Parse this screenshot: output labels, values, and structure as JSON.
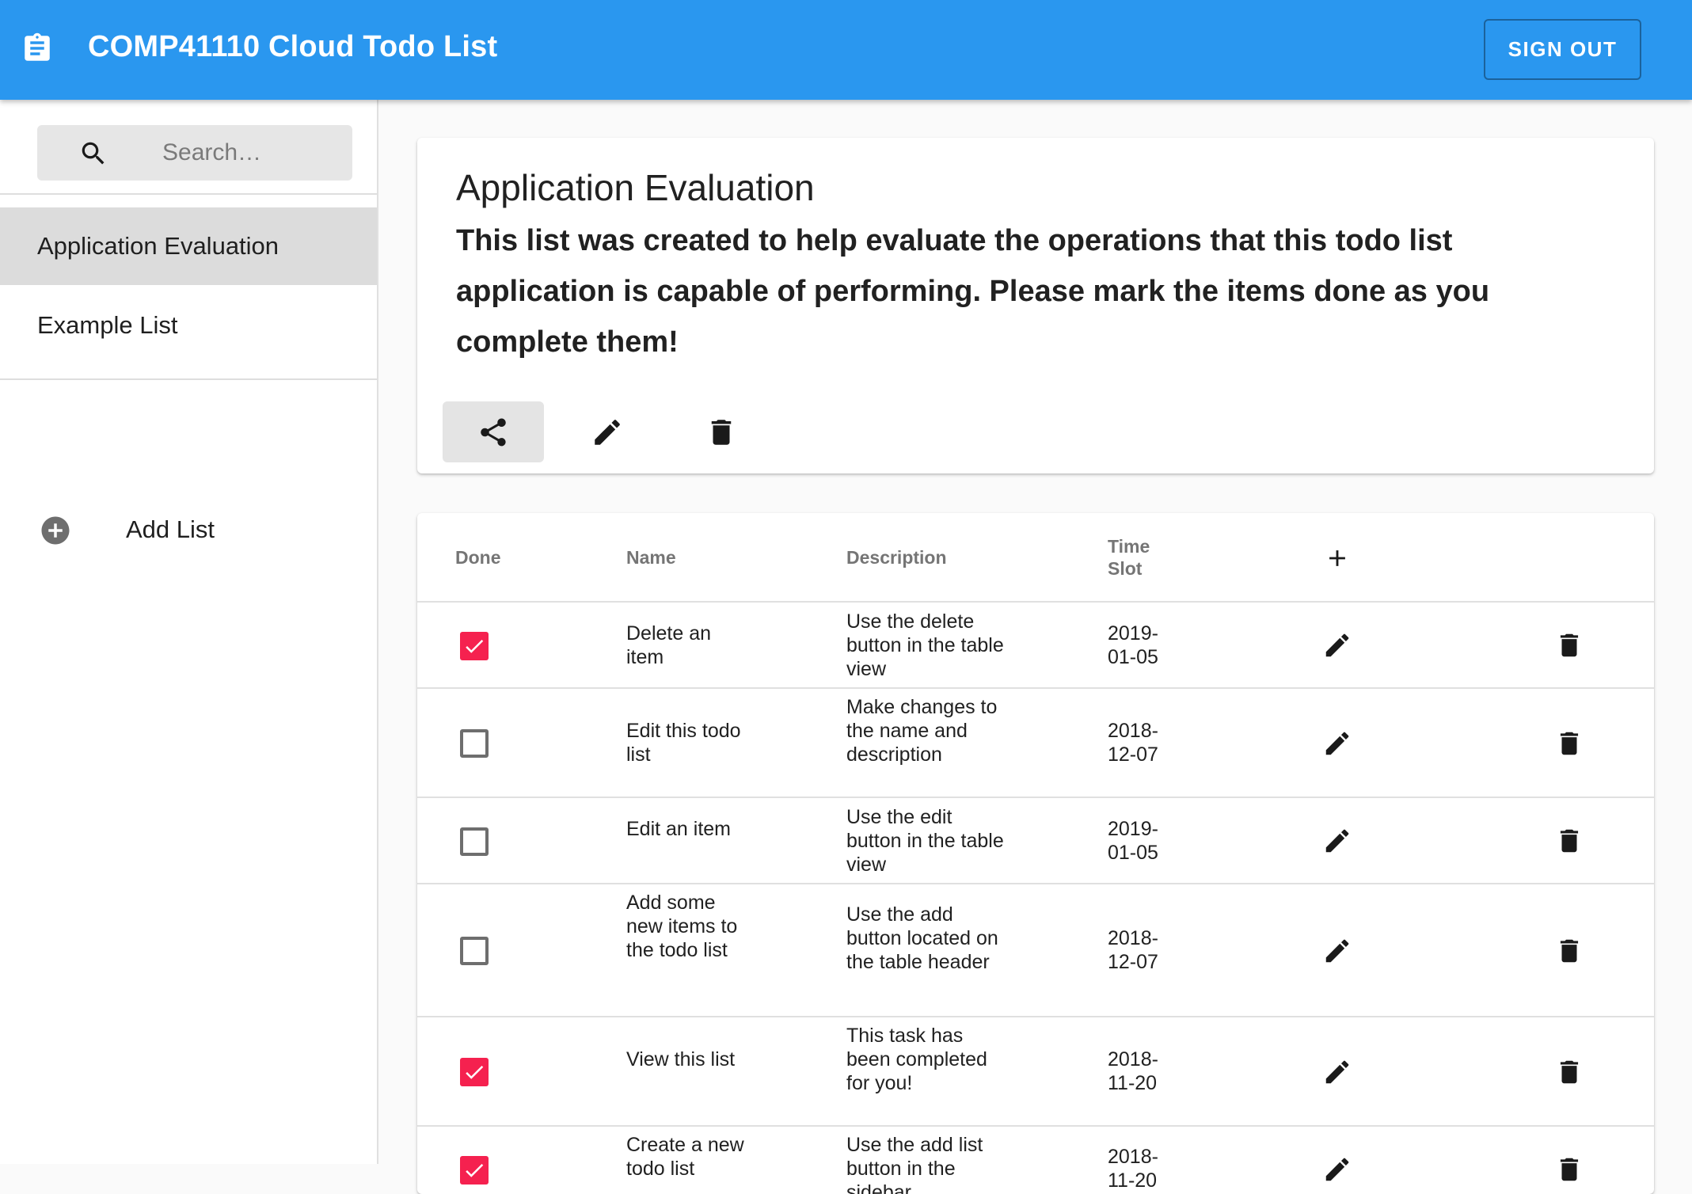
{
  "app": {
    "title": "COMP41110 Cloud Todo List",
    "signout_label": "SIGN OUT",
    "brand_color": "#2a97ef",
    "accent_color": "#f5214f"
  },
  "sidebar": {
    "search_placeholder": "Search…",
    "lists": [
      {
        "label": "Application Evaluation",
        "selected": true
      },
      {
        "label": "Example List",
        "selected": false
      }
    ],
    "add_list_label": "Add List"
  },
  "current_list": {
    "title": "Application Evaluation",
    "description": "This list was created to help evaluate the operations that this todo list application is capable of performing. Please mark the items done as you complete them!",
    "actions": [
      "share-icon",
      "edit-icon",
      "delete-icon"
    ]
  },
  "table": {
    "headers": {
      "done": "Done",
      "name": "Name",
      "description": "Description",
      "time_slot": "Time Slot"
    },
    "rows": [
      {
        "done": true,
        "name": "Delete an item",
        "description": "Use the delete button in the table view",
        "time_slot": "2019-01-05"
      },
      {
        "done": false,
        "name": "Edit this todo list",
        "description": "Make changes to the name and description",
        "time_slot": "2018-12-07"
      },
      {
        "done": false,
        "name": "Edit an item",
        "description": "Use the edit button in the table view",
        "time_slot": "2019-01-05"
      },
      {
        "done": false,
        "name": "Add some new items to the todo list",
        "description": "Use the add button located on the table header",
        "time_slot": "2018-12-07"
      },
      {
        "done": true,
        "name": "View this list",
        "description": "This task has been completed for you!",
        "time_slot": "2018-11-20"
      },
      {
        "done": true,
        "name": "Create a new todo list",
        "description": "Use the add list button in the sidebar",
        "time_slot": "2018-11-20"
      }
    ]
  }
}
